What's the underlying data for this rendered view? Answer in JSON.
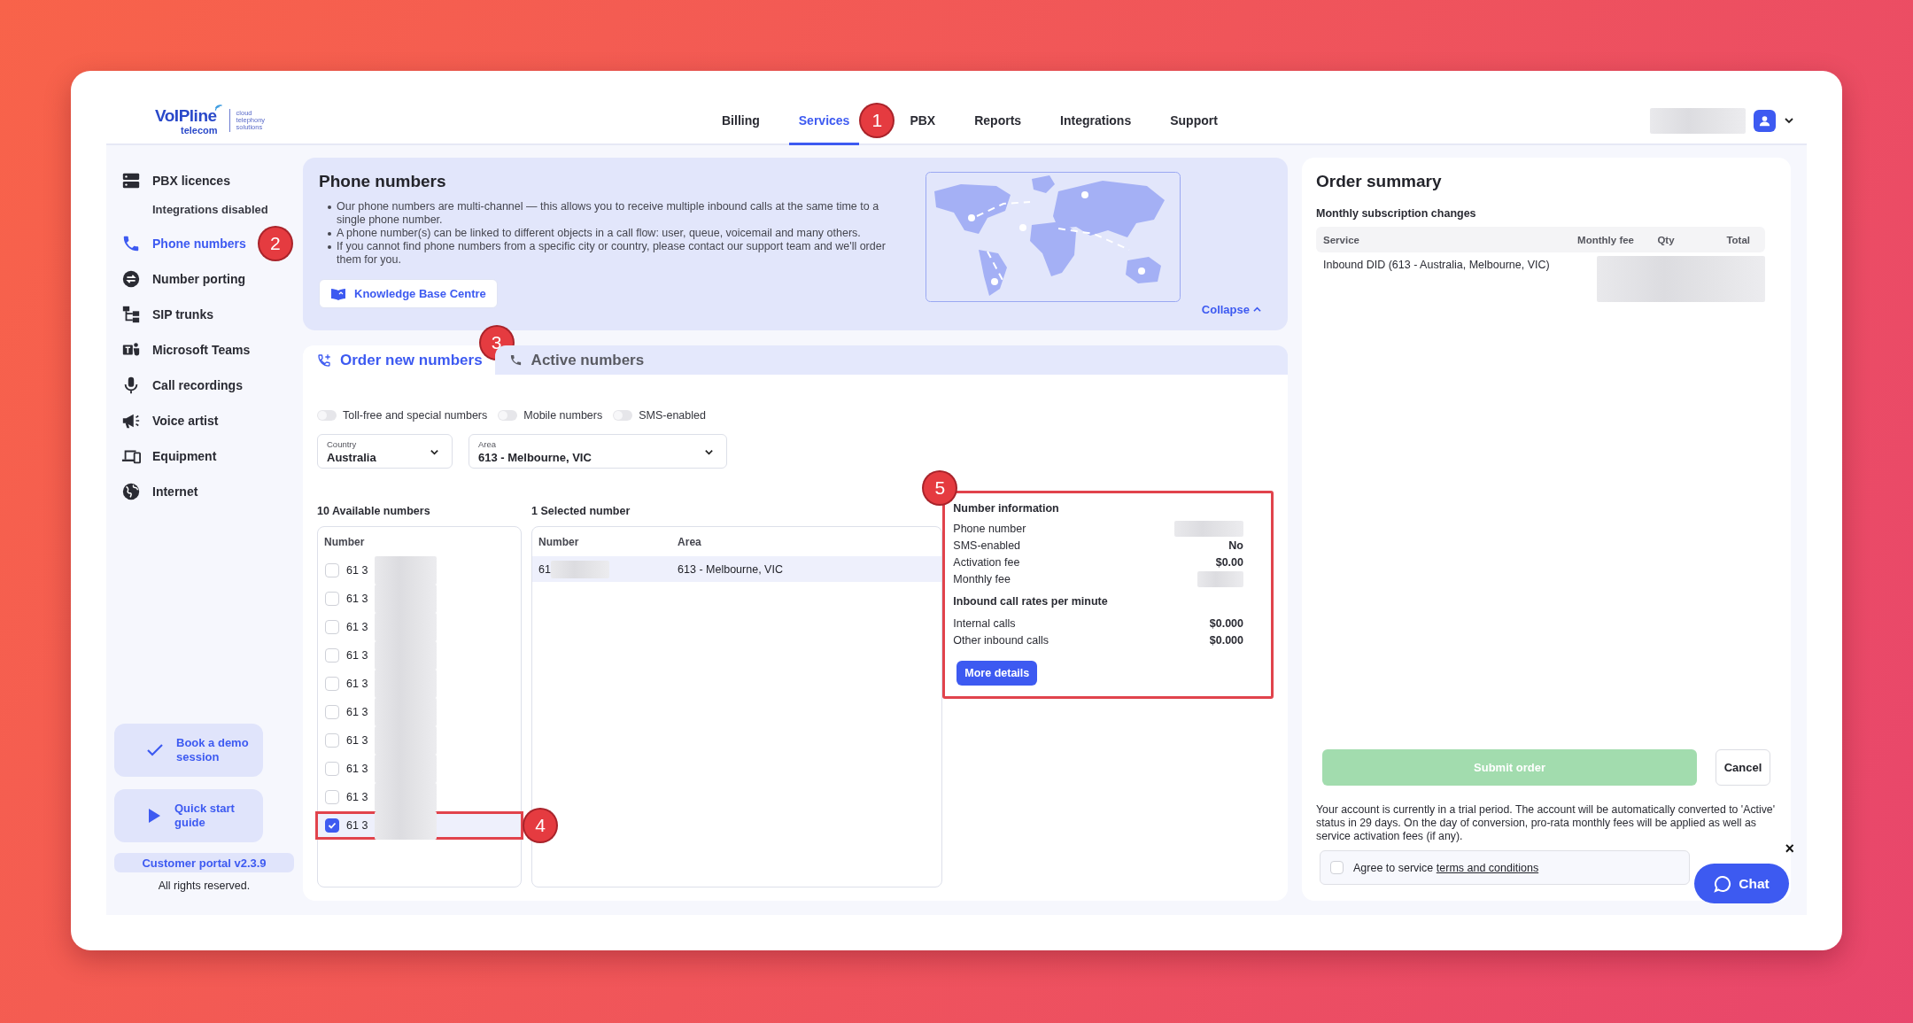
{
  "logo": {
    "brand": "VoIPline",
    "sub": "telecom",
    "tagline": [
      "cloud",
      "telephony",
      "solutions"
    ]
  },
  "nav": [
    {
      "label": "Billing",
      "selected": false
    },
    {
      "label": "Services",
      "selected": true,
      "marker": "1"
    },
    {
      "label": "PBX",
      "selected": false
    },
    {
      "label": "Reports",
      "selected": false
    },
    {
      "label": "Integrations",
      "selected": false
    },
    {
      "label": "Support",
      "selected": false
    }
  ],
  "sidebar": {
    "items": [
      {
        "label": "PBX licences",
        "selected": false,
        "note": "Integrations disabled"
      },
      {
        "label": "Phone numbers",
        "selected": true,
        "marker": "2"
      },
      {
        "label": "Number porting",
        "selected": false
      },
      {
        "label": "SIP trunks",
        "selected": false
      },
      {
        "label": "Microsoft Teams",
        "selected": false
      },
      {
        "label": "Call recordings",
        "selected": false
      },
      {
        "label": "Voice artist",
        "selected": false
      },
      {
        "label": "Equipment",
        "selected": false
      },
      {
        "label": "Internet",
        "selected": false
      }
    ],
    "promos": [
      {
        "label": "Book a demo session"
      },
      {
        "label": "Quick start guide"
      }
    ],
    "version": "Customer portal v2.3.9",
    "footer": "All rights reserved."
  },
  "info": {
    "title": "Phone numbers",
    "bullets": [
      "Our phone numbers are multi-channel — this allows you to receive multiple inbound calls at the same time to a single phone number.",
      "A phone number(s) can be linked to different objects in a call flow: user, queue, voicemail and many others.",
      "If you cannot find phone numbers from a specific city or country, please contact our support team and we'll order them for you."
    ],
    "button": "Knowledge Base Centre",
    "collapse": "Collapse"
  },
  "tabs": [
    {
      "label": "Order new numbers",
      "selected": true,
      "marker": "3"
    },
    {
      "label": "Active numbers",
      "selected": false
    }
  ],
  "filters": [
    {
      "label": "Toll-free and special numbers",
      "on": false
    },
    {
      "label": "Mobile numbers",
      "on": false
    },
    {
      "label": "SMS-enabled",
      "on": false
    }
  ],
  "selects": [
    {
      "label": "Country",
      "value": "Australia"
    },
    {
      "label": "Area",
      "value": "613 - Melbourne, VIC"
    }
  ],
  "available": {
    "title": "10 Available numbers",
    "column": "Number",
    "rows": [
      {
        "number": "61 3",
        "checked": false,
        "highlighted": false
      },
      {
        "number": "61 3",
        "checked": false,
        "highlighted": false
      },
      {
        "number": "61 3",
        "checked": false,
        "highlighted": false
      },
      {
        "number": "61 3",
        "checked": false,
        "highlighted": false
      },
      {
        "number": "61 3",
        "checked": false,
        "highlighted": false
      },
      {
        "number": "61 3",
        "checked": false,
        "highlighted": false
      },
      {
        "number": "61 3",
        "checked": false,
        "highlighted": false
      },
      {
        "number": "61 3",
        "checked": false,
        "highlighted": false
      },
      {
        "number": "61 3",
        "checked": false,
        "highlighted": false
      },
      {
        "number": "61 3",
        "checked": true,
        "highlighted": true,
        "marker": "4"
      }
    ]
  },
  "selected_numbers": {
    "title": "1 Selected number",
    "columns": [
      "Number",
      "Area"
    ],
    "rows": [
      {
        "number": "61",
        "area": "613 - Melbourne, VIC"
      }
    ]
  },
  "number_info": {
    "title": "Number information",
    "highlighted": true,
    "marker": "5",
    "rows": [
      {
        "label": "Phone number"
      },
      {
        "label": "SMS-enabled",
        "value": "No"
      },
      {
        "label": "Activation fee",
        "value": "$0.00"
      },
      {
        "label": "Monthly fee"
      }
    ],
    "rates_title": "Inbound call rates per minute",
    "rates": [
      {
        "label": "Internal calls",
        "value": "$0.000"
      },
      {
        "label": "Other inbound calls",
        "value": "$0.000"
      }
    ],
    "button": "More details"
  },
  "order_summary": {
    "title": "Order summary",
    "subtitle": "Monthly subscription changes",
    "columns": [
      "Service",
      "Monthly fee",
      "Qty",
      "Total"
    ],
    "rows": [
      {
        "service": "Inbound DID (613 - Australia, Melbourne, VIC)"
      }
    ],
    "submit": {
      "label": "Submit order",
      "disabled": true
    },
    "cancel": "Cancel",
    "notice": "Your account is currently in a trial period. The account will be automatically converted to 'Active' status in 29 days. On the day of conversion, pro-rata monthly fees will be applied as well as service activation fees (if any).",
    "agree": {
      "label": "Agree to service",
      "link": "terms and conditions",
      "checked": false
    }
  },
  "chat": {
    "label": "Chat",
    "close": "×"
  }
}
